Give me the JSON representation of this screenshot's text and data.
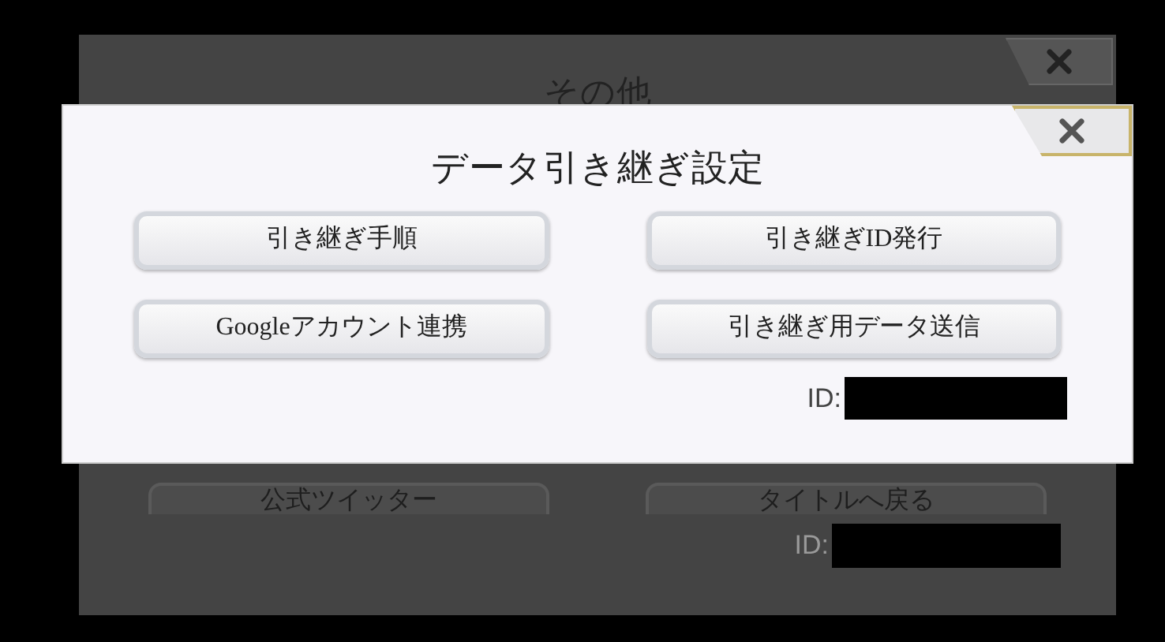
{
  "background_panel": {
    "title": "その他",
    "buttons": [
      "公式ツイッター",
      "タイトルへ戻る"
    ],
    "id_label": "ID:"
  },
  "dialog": {
    "title": "データ引き継ぎ設定",
    "buttons": [
      "引き継ぎ手順",
      "引き継ぎID発行",
      "Googleアカウント連携",
      "引き継ぎ用データ送信"
    ],
    "id_label": "ID:"
  }
}
